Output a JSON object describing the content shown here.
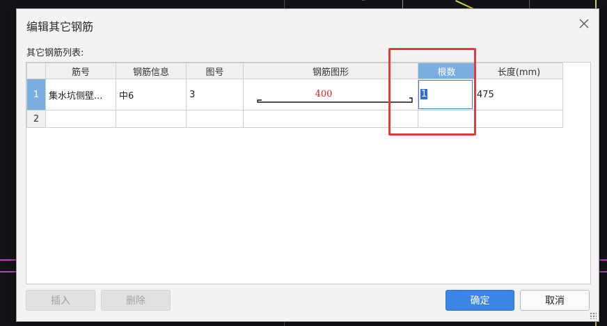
{
  "dialog": {
    "title": "编辑其它钢筋",
    "list_label": "其它钢筋列表:"
  },
  "grid": {
    "columns": [
      "筋号",
      "钢筋信息",
      "图号",
      "钢筋图形",
      "根数",
      "长度(mm)"
    ],
    "active_column": "根数",
    "rows": [
      {
        "index": "1",
        "bar_no": "集水坑侧壁...",
        "bar_info": "中6",
        "shape_no": "3",
        "shape_dimension": "400",
        "count": "1",
        "length": "475"
      },
      {
        "index": "2",
        "bar_no": "",
        "bar_info": "",
        "shape_no": "",
        "shape_dimension": "",
        "count": "",
        "length": ""
      }
    ]
  },
  "buttons": {
    "insert": "插入",
    "delete": "删除",
    "ok": "确定",
    "cancel": "取消"
  },
  "colors": {
    "highlight": "#e63a3a",
    "accent": "#3c85e6",
    "active_header": "#7aaee0"
  }
}
